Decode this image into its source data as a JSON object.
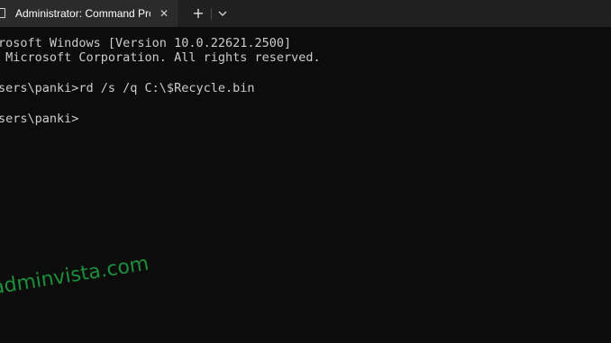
{
  "tab": {
    "title": "Administrator: Command Pro",
    "close_glyph": "✕",
    "icon": "terminal-icon"
  },
  "toolbar": {
    "new_tab_glyph": "+",
    "dropdown_icon": "chevron-down-icon"
  },
  "terminal": {
    "lines": [
      "rosoft Windows [Version 10.0.22621.2500]",
      " Microsoft Corporation. All rights reserved.",
      "",
      "sers\\panki>rd /s /q C:\\$Recycle.bin",
      "",
      "sers\\panki>"
    ]
  },
  "watermark": {
    "text": "adminvista.com"
  },
  "colors": {
    "background": "#0c0c0c",
    "titlebar": "#202020",
    "tab": "#2b2b2b",
    "text": "#cccccc",
    "watermark": "#1c8f3a"
  }
}
